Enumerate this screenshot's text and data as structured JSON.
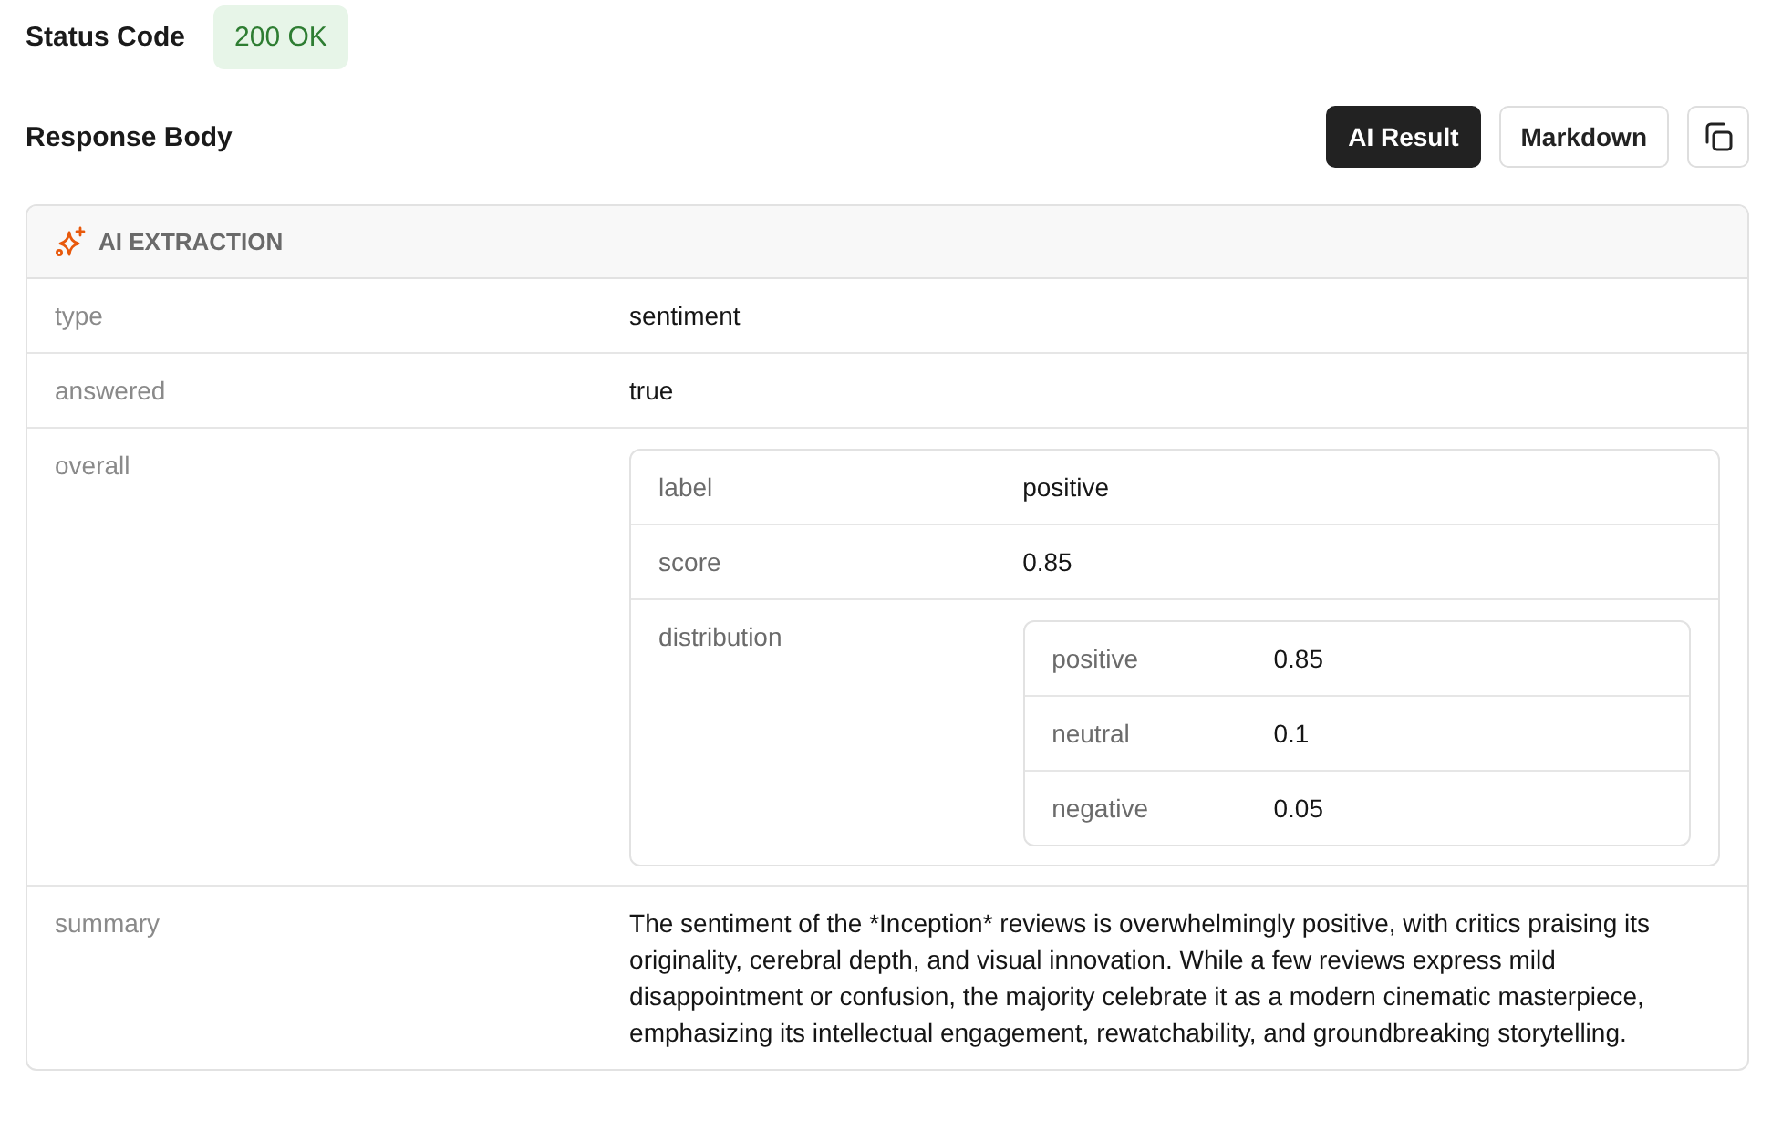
{
  "status": {
    "label": "Status Code",
    "badge": "200 OK"
  },
  "response_body": {
    "title": "Response Body",
    "view_tabs": [
      {
        "label": "AI Result",
        "selected": true
      },
      {
        "label": "Markdown",
        "selected": false
      }
    ]
  },
  "extraction": {
    "title": "AI EXTRACTION",
    "fields": [
      {
        "key": "type",
        "kind": "text",
        "value": "sentiment"
      },
      {
        "key": "answered",
        "kind": "text",
        "value": "true"
      },
      {
        "key": "overall",
        "kind": "object",
        "fields": [
          {
            "key": "label",
            "kind": "text",
            "value": "positive"
          },
          {
            "key": "score",
            "kind": "text",
            "value": "0.85"
          },
          {
            "key": "distribution",
            "kind": "object",
            "fields": [
              {
                "key": "positive",
                "kind": "text",
                "value": "0.85"
              },
              {
                "key": "neutral",
                "kind": "text",
                "value": "0.1"
              },
              {
                "key": "negative",
                "kind": "text",
                "value": "0.05"
              }
            ]
          }
        ]
      },
      {
        "key": "summary",
        "kind": "text",
        "value": "The sentiment of the *Inception* reviews is overwhelmingly positive, with critics praising its originality, cerebral depth, and visual innovation. While a few reviews express mild disappointment or confusion, the majority celebrate it as a modern cinematic masterpiece, emphasizing its intellectual engagement, rewatchability, and groundbreaking storytelling."
      }
    ]
  }
}
